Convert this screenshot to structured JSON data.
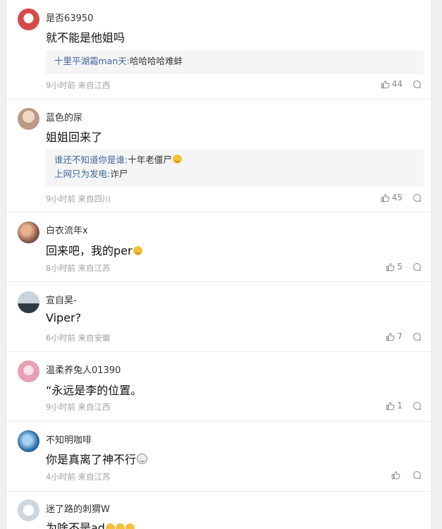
{
  "comments": [
    {
      "username": "是否63950",
      "text": "就不能是他姐吗",
      "replies": [
        {
          "user": "十里平湖霜man天:",
          "text": "哈哈哈哈难蚌"
        }
      ],
      "time": "9小时前",
      "location": "来自江西",
      "likes": "44",
      "avatar_color": "#d64a4a"
    },
    {
      "username": "蓝色的尿",
      "text": "姐姐回来了",
      "replies": [
        {
          "user": "谁还不知道你是谁:",
          "text": "十年老僵尸",
          "emoji": "laugh-emoji"
        },
        {
          "user": "上网只为发电:",
          "text": "诈尸"
        }
      ],
      "time": "9小时前",
      "location": "来自四川",
      "likes": "45",
      "avatar_color": "#b89a86"
    },
    {
      "username": "白衣流年x",
      "text": "回来吧，我的per",
      "text_emoji": "cry-emoji",
      "replies": [],
      "time": "8小时前",
      "location": "来自江苏",
      "likes": "5",
      "avatar_color": "#8a5a4a"
    },
    {
      "username": "宣自昊-",
      "text": "Viper?",
      "replies": [],
      "time": "6小时前",
      "location": "来自安徽",
      "likes": "7",
      "avatar_color": "#5d6b78"
    },
    {
      "username": "温柔养兔人01390",
      "text": "“永远是李的位置。",
      "replies": [],
      "time": "9小时前",
      "location": "来自江西",
      "likes": "1",
      "avatar_color": "#e8a0b4"
    },
    {
      "username": "不知明咖啡",
      "text": "你是真离了神不行",
      "text_emoji": "dizzy-emoji",
      "replies": [],
      "time": "4小时前",
      "location": "来自江苏",
      "likes": "",
      "avatar_color": "#2b6fa8"
    },
    {
      "username": "迷了路的刺猬W",
      "text": "为啥不是ad",
      "text_emoji": "laugh-emoji x3",
      "replies": [],
      "time": "",
      "location": "",
      "likes": "",
      "avatar_color": "#cfd6dc"
    }
  ]
}
